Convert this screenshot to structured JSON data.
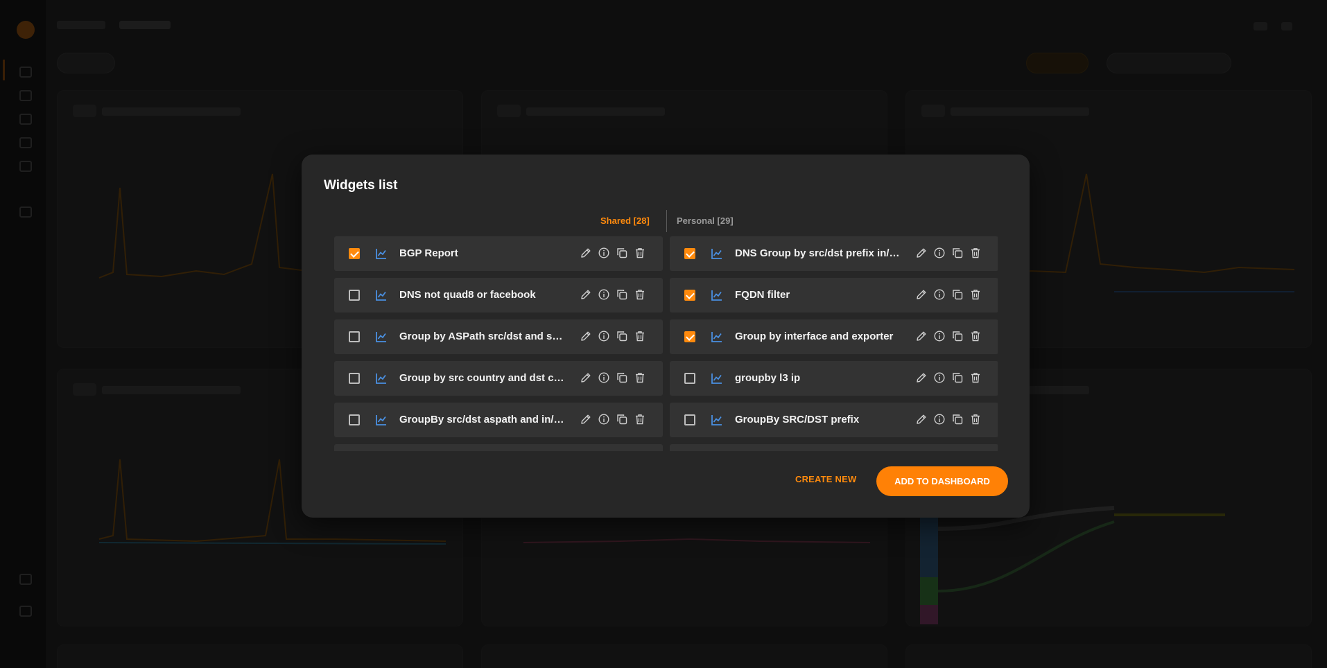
{
  "modal": {
    "title": "Widgets list",
    "tabs": [
      {
        "label": "Shared [28]",
        "active": true
      },
      {
        "label": "Personal [29]",
        "active": false
      }
    ],
    "widgets_left": [
      {
        "name": "BGP Report",
        "checked": true
      },
      {
        "name": "DNS not quad8 or facebook",
        "checked": false
      },
      {
        "name": "Group by ASPath src/dst and src...",
        "checked": false
      },
      {
        "name": "Group by src country and dst cit...",
        "checked": false
      },
      {
        "name": "GroupBy src/dst aspath and in/o...",
        "checked": false
      }
    ],
    "widgets_right": [
      {
        "name": "DNS Group by src/dst prefix in/o...",
        "checked": true
      },
      {
        "name": "FQDN filter",
        "checked": true
      },
      {
        "name": "Group by interface and exporter",
        "checked": true
      },
      {
        "name": "groupby l3 ip",
        "checked": false
      },
      {
        "name": "GroupBy SRC/DST prefix",
        "checked": false
      }
    ],
    "row_icons": [
      "line-chart-icon",
      "edit-icon",
      "info-icon",
      "duplicate-icon",
      "delete-icon"
    ],
    "create_new_label": "CREATE NEW",
    "add_to_dashboard_label": "ADD TO DASHBOARD"
  },
  "colors": {
    "accent": "#ff8a0d",
    "chart_icon": "#4a90e2",
    "modal_bg": "#272727",
    "row_bg": "#333333"
  }
}
